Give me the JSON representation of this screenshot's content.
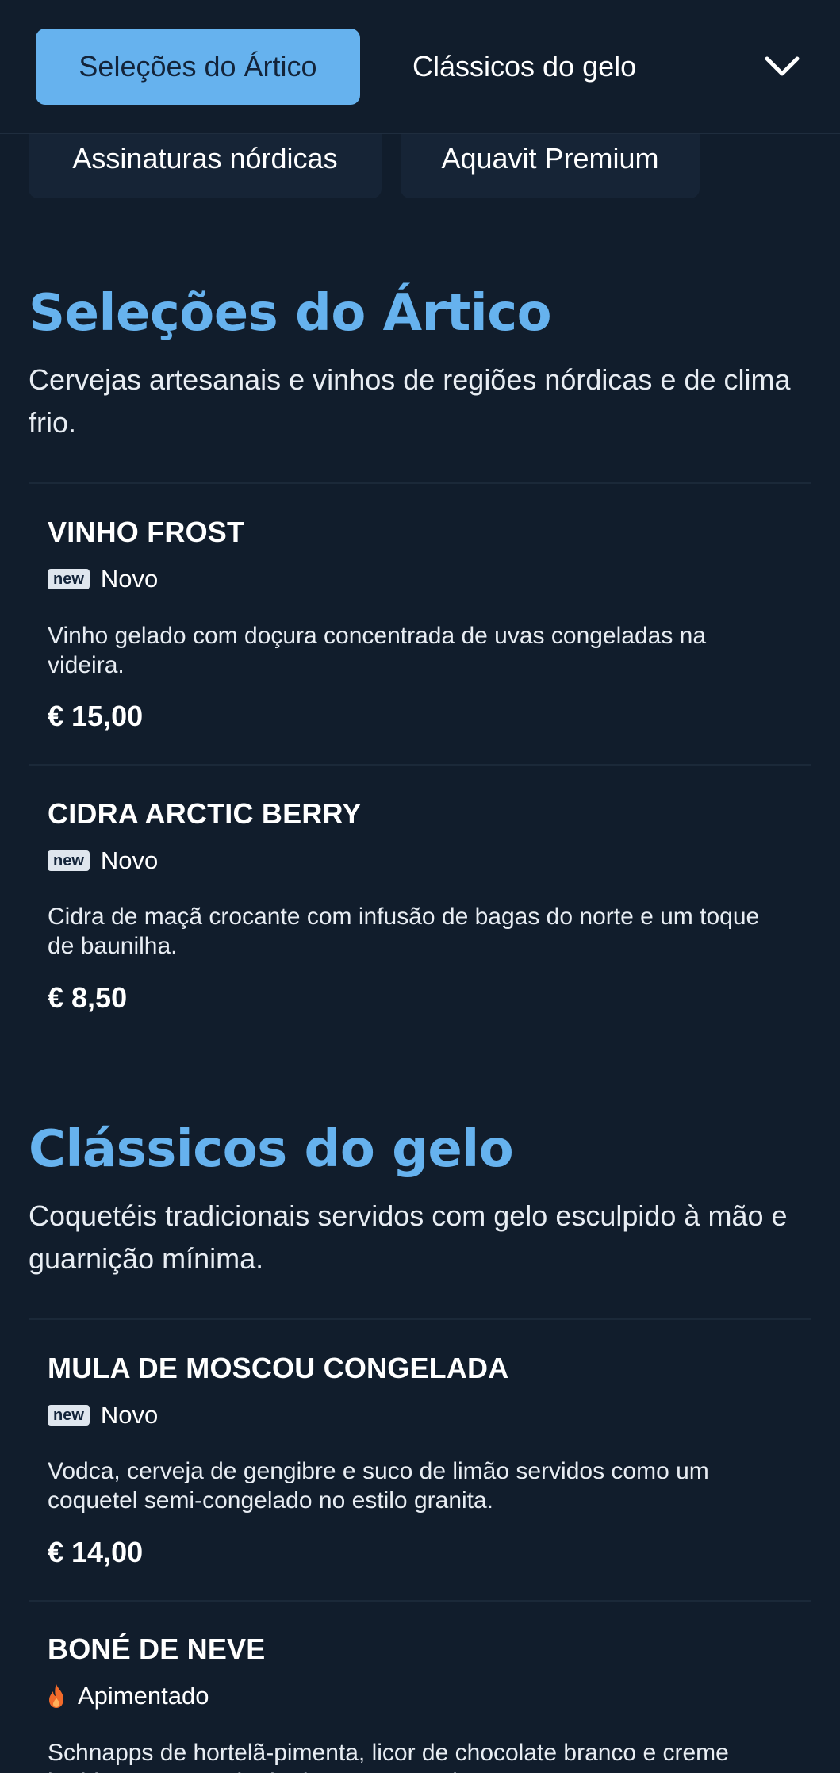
{
  "nav": {
    "tabs": [
      "Seleções do Ártico",
      "Clássicos do gelo",
      "Assinaturas nórdicas",
      "Aquavit Premium"
    ],
    "active_tab": "Seleções do Ártico",
    "expand_icon": "chevron-down-icon"
  },
  "sections": [
    {
      "title": "Seleções do Ártico",
      "description": "Cervejas artesanais e vinhos de regiões nórdicas e de clima frio.",
      "items": [
        {
          "name": "VINHO FROST",
          "tag": {
            "badge": "new",
            "label": "Novo"
          },
          "description": "Vinho gelado com doçura concentrada de uvas congeladas na videira.",
          "price": "€ 15,00"
        },
        {
          "name": "CIDRA ARCTIC BERRY",
          "tag": {
            "badge": "new",
            "label": "Novo"
          },
          "description": "Cidra de maçã crocante com infusão de bagas do norte e um toque de baunilha.",
          "price": "€ 8,50"
        }
      ]
    },
    {
      "title": "Clássicos do gelo",
      "description": "Coquetéis tradicionais servidos com gelo esculpido à mão e guarnição mínima.",
      "items": [
        {
          "name": "MULA DE MOSCOU CONGELADA",
          "tag": {
            "badge": "new",
            "label": "Novo"
          },
          "description": "Vodca, cerveja de gengibre e suco de limão servidos como um coquetel semi-congelado no estilo granita.",
          "price": "€ 14,00"
        },
        {
          "name": "BONÉ DE NEVE",
          "tag": {
            "icon": "fire-icon",
            "label": "Apimentado"
          },
          "description": "Schnapps de hortelã-pimenta, licor de chocolate branco e creme batido com uma pitada de noz-moscada.",
          "price": ""
        }
      ]
    }
  ],
  "colors": {
    "background": "#111d2c",
    "accent": "#66b2ee",
    "tab_surface": "#162436",
    "badge": "#dfe6ee",
    "fire": "#f26a2a"
  }
}
